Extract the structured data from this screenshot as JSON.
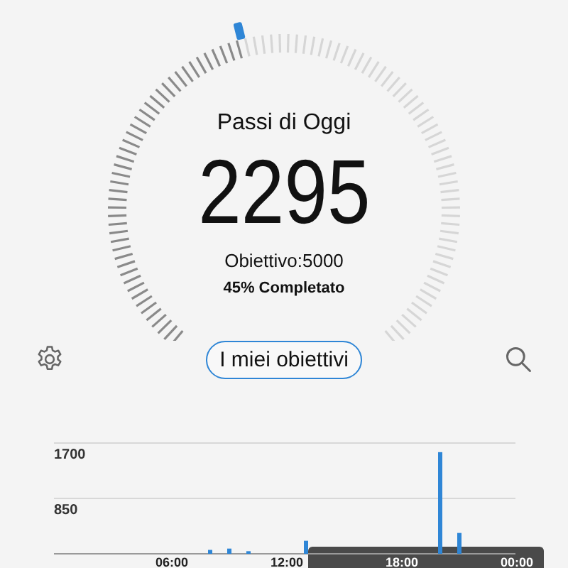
{
  "gauge": {
    "title": "Passi di Oggi",
    "steps": "2295",
    "goal": "Obiettivo:5000",
    "progress_text": "45% Completato"
  },
  "toolbar": {
    "goals_button": "I miei obiettivi"
  },
  "activity": {
    "chart_data": {
      "type": "bar",
      "x": [
        8,
        9,
        10,
        13,
        20,
        21
      ],
      "series": [
        {
          "color": "#2f86d6",
          "values": [
            60,
            80,
            40,
            200,
            1560,
            320
          ]
        }
      ],
      "xlim": [
        0,
        24
      ],
      "xticks": [
        {
          "value": 6,
          "label": "06:00"
        },
        {
          "value": 12,
          "label": "12:00"
        },
        {
          "value": 18,
          "label": "18:00"
        },
        {
          "value": 24,
          "label": "00:00"
        }
      ],
      "ylim": [
        0,
        1700
      ],
      "yticks": [
        {
          "value": 850,
          "label": "850"
        },
        {
          "value": 1700,
          "label": "1700"
        }
      ]
    }
  }
}
